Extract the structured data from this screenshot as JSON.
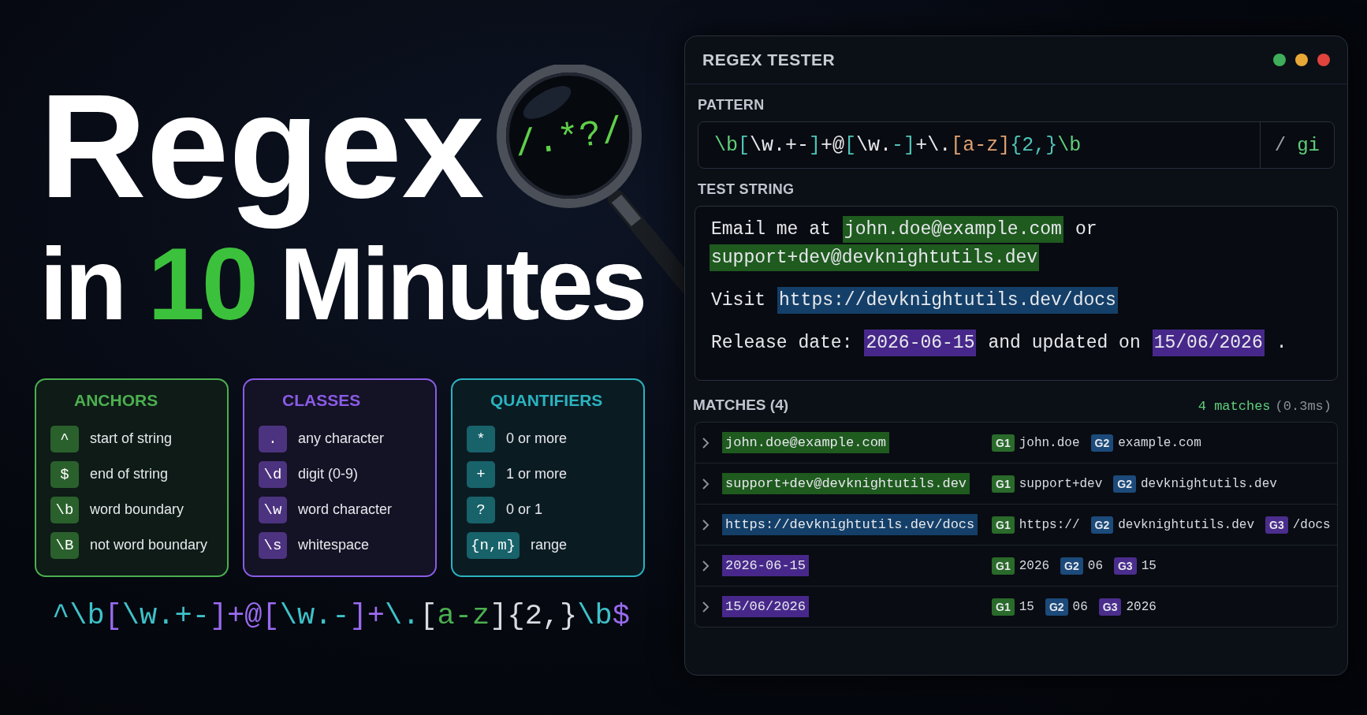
{
  "title": {
    "line1": "Regex",
    "line2": [
      {
        "text": "in",
        "accent": false
      },
      {
        "text": "10",
        "accent": true
      },
      {
        "text": "Minutes",
        "accent": false
      }
    ]
  },
  "magnifier": {
    "text": "/.*?/"
  },
  "cards": [
    {
      "title": "ANCHORS",
      "color": "#4caf50",
      "items": [
        {
          "token": "^",
          "desc": "start of string"
        },
        {
          "token": "$",
          "desc": "end of string"
        },
        {
          "token": "\\b",
          "desc": "word boundary"
        },
        {
          "token": "\\B",
          "desc": "not word boundary"
        }
      ]
    },
    {
      "title": "CLASSES",
      "color": "#8a5ce6",
      "items": [
        {
          "token": ".",
          "desc": "any character"
        },
        {
          "token": "\\d",
          "desc": "digit (0-9)"
        },
        {
          "token": "\\w",
          "desc": "word character"
        },
        {
          "token": "\\s",
          "desc": "whitespace"
        }
      ]
    },
    {
      "title": "QUANTIFIERS",
      "color": "#2bb3c0",
      "items": [
        {
          "token": "*",
          "desc": "0 or more"
        },
        {
          "token": "+",
          "desc": "1 or more"
        },
        {
          "token": "?",
          "desc": "0 or 1"
        },
        {
          "token": "{n,m}",
          "desc": "range"
        }
      ]
    }
  ],
  "footer_pattern": [
    {
      "text": "^\\b",
      "color": "#3fc1c9"
    },
    {
      "text": "[",
      "color": "#9a6bf0"
    },
    {
      "text": "\\w.+-",
      "color": "#3fc1c9"
    },
    {
      "text": "]+@[",
      "color": "#9a6bf0"
    },
    {
      "text": "\\w.-",
      "color": "#3fc1c9"
    },
    {
      "text": "]+",
      "color": "#9a6bf0"
    },
    {
      "text": "\\.",
      "color": "#3fc1c9"
    },
    {
      "text": "[",
      "color": "#d8dbe0"
    },
    {
      "text": "a-z",
      "color": "#4caf50"
    },
    {
      "text": "]{2,}",
      "color": "#d8dbe0"
    },
    {
      "text": "\\b",
      "color": "#3fc1c9"
    },
    {
      "text": "$",
      "color": "#9a6bf0"
    }
  ],
  "window": {
    "title": "REGEX TESTER",
    "pattern_label": "PATTERN",
    "pattern": [
      {
        "text": "\\b",
        "color": "#5fcf7a"
      },
      {
        "text": "[",
        "color": "#4fc3b8"
      },
      {
        "text": "\\w.+-",
        "color": "#e6e8ec"
      },
      {
        "text": "]",
        "color": "#4fc3b8"
      },
      {
        "text": "+@",
        "color": "#e6e8ec"
      },
      {
        "text": "[",
        "color": "#4fc3b8"
      },
      {
        "text": "\\w.",
        "color": "#e6e8ec"
      },
      {
        "text": "-]",
        "color": "#4fc3b8"
      },
      {
        "text": "+\\.",
        "color": "#e6e8ec"
      },
      {
        "text": "[a-z]",
        "color": "#e0a070"
      },
      {
        "text": "{2,}",
        "color": "#4fc3b8"
      },
      {
        "text": "\\b",
        "color": "#5fcf7a"
      }
    ],
    "flags_separator": "/",
    "flags": "gi",
    "test_label": "TEST STRING",
    "test_paragraphs": [
      [
        {
          "text": "Email me at",
          "kind": "plain"
        },
        {
          "text": "john.doe@example.com",
          "kind": "email"
        },
        {
          "text": "or",
          "kind": "plain"
        },
        {
          "text": "support+dev@devknightutils.dev",
          "kind": "email"
        }
      ],
      [
        {
          "text": "Visit",
          "kind": "plain"
        },
        {
          "text": "https://devknightutils.dev/docs",
          "kind": "url"
        }
      ],
      [
        {
          "text": "Release date:",
          "kind": "plain"
        },
        {
          "text": "2026-06-15",
          "kind": "date"
        },
        {
          "text": "and updated on",
          "kind": "plain"
        },
        {
          "text": "15/06/2026",
          "kind": "date"
        },
        {
          "text": ".",
          "kind": "plain"
        }
      ]
    ],
    "matches_label": "MATCHES (4)",
    "matches_count": "4 matches",
    "matches_time": "(0.3ms)",
    "matches": [
      {
        "text": "john.doe@example.com",
        "kind": "email",
        "groups": [
          {
            "label": "G1",
            "color": "#2a6a2a",
            "value": "john.doe"
          },
          {
            "label": "G2",
            "color": "#1c4a7a",
            "value": "example.com"
          }
        ]
      },
      {
        "text": "support+dev@devknightutils.dev",
        "kind": "email",
        "groups": [
          {
            "label": "G1",
            "color": "#2a6a2a",
            "value": "support+dev"
          },
          {
            "label": "G2",
            "color": "#1c4a7a",
            "value": "devknightutils.dev"
          }
        ]
      },
      {
        "text": "https://devknightutils.dev/docs",
        "kind": "url",
        "groups": [
          {
            "label": "G1",
            "color": "#2a6a2a",
            "value": "https://"
          },
          {
            "label": "G2",
            "color": "#1c4a7a",
            "value": "devknightutils.dev"
          },
          {
            "label": "G3",
            "color": "#4a2d8c",
            "value": "/docs"
          }
        ]
      },
      {
        "text": "2026-06-15",
        "kind": "date",
        "groups": [
          {
            "label": "G1",
            "color": "#2a6a2a",
            "value": "2026"
          },
          {
            "label": "G2",
            "color": "#1c4a7a",
            "value": "06"
          },
          {
            "label": "G3",
            "color": "#4a2d8c",
            "value": "15"
          }
        ]
      },
      {
        "text": "15/06/2026",
        "kind": "date",
        "groups": [
          {
            "label": "G1",
            "color": "#2a6a2a",
            "value": "15"
          },
          {
            "label": "G2",
            "color": "#1c4a7a",
            "value": "06"
          },
          {
            "label": "G3",
            "color": "#4a2d8c",
            "value": "2026"
          }
        ]
      }
    ]
  }
}
